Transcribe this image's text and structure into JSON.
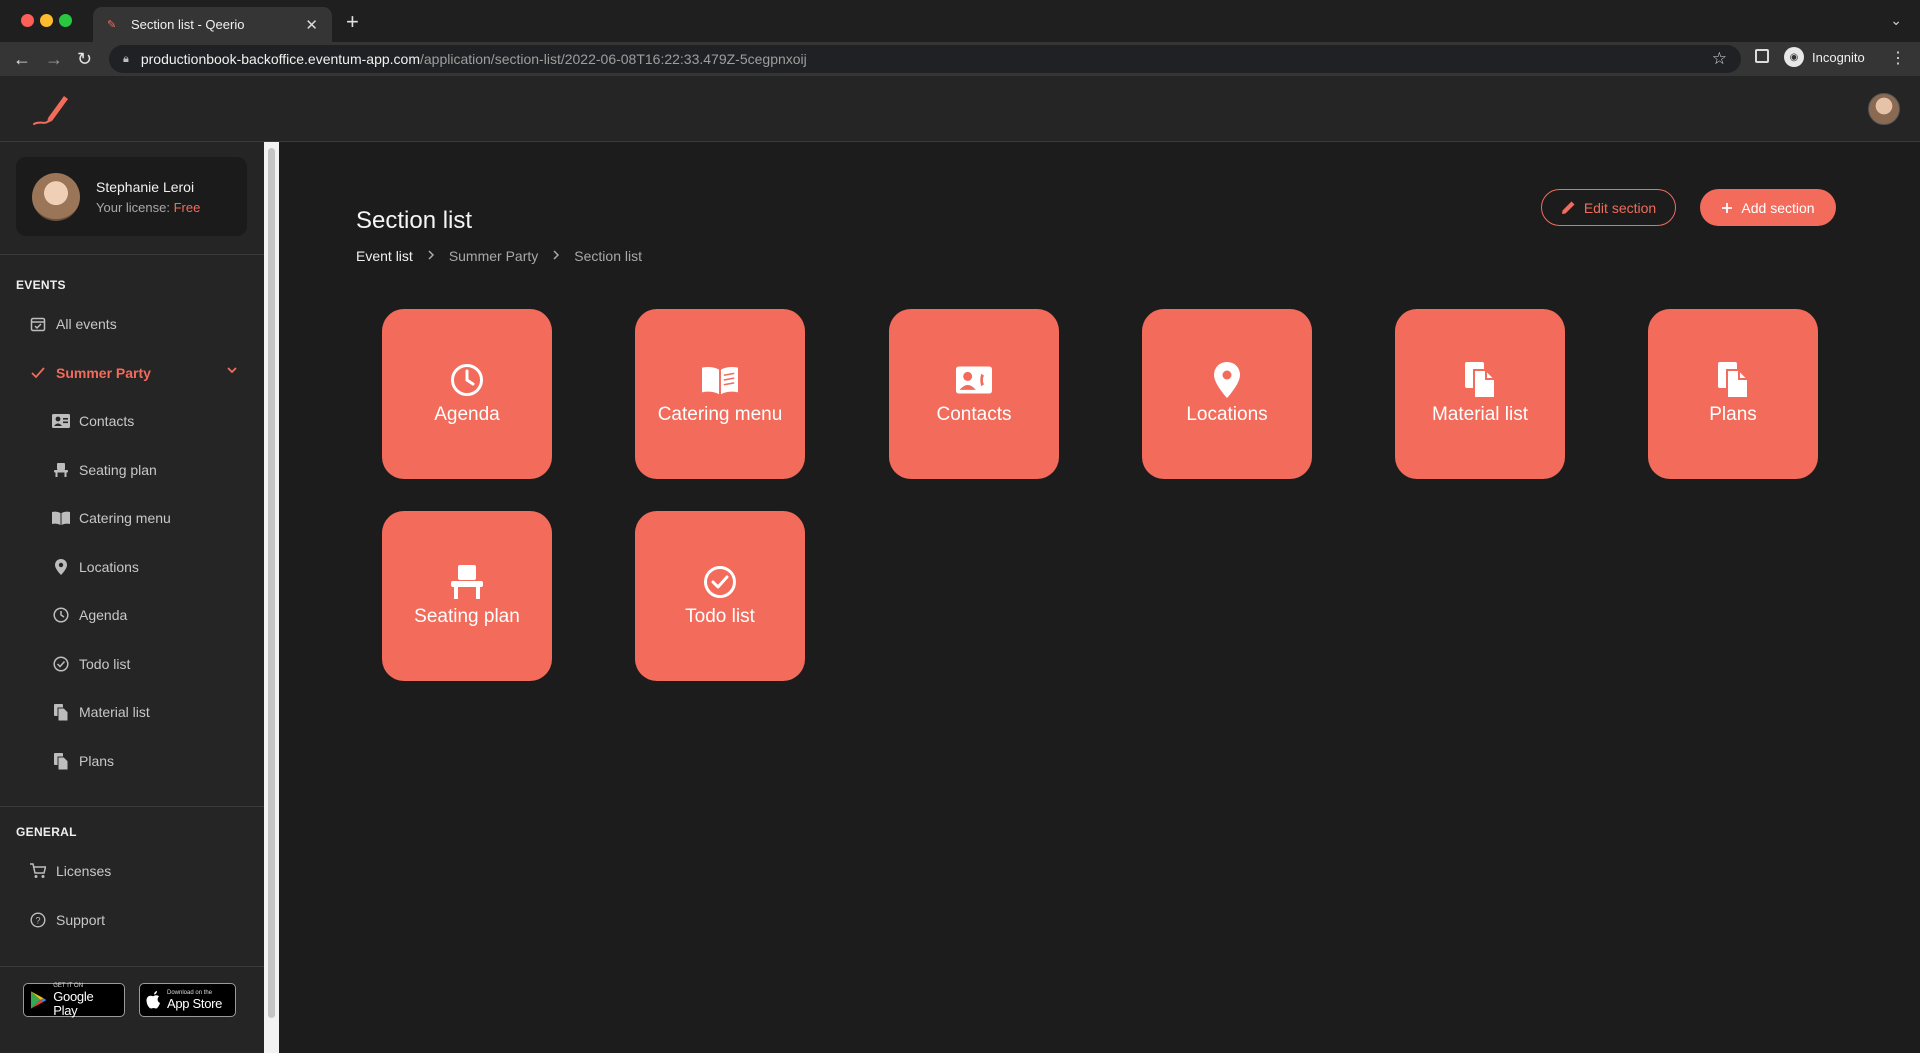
{
  "browser": {
    "tab_title": "Section list - Qeerio",
    "url_host": "productionbook-backoffice.eventum-app.com",
    "url_path": "/application/section-list/2022-06-08T16:22:33.479Z-5cegpnxoij",
    "profile_label": "Incognito"
  },
  "profile": {
    "name": "Stephanie Leroi",
    "license_label": "Your license:",
    "license_value": "Free"
  },
  "sidebar": {
    "events_label": "EVENTS",
    "all_events": "All events",
    "current_event": "Summer Party",
    "event_items": [
      {
        "label": "Contacts",
        "icon": "contacts-icon"
      },
      {
        "label": "Seating plan",
        "icon": "seat-icon"
      },
      {
        "label": "Catering menu",
        "icon": "book-icon"
      },
      {
        "label": "Locations",
        "icon": "location-pin-icon"
      },
      {
        "label": "Agenda",
        "icon": "clock-icon"
      },
      {
        "label": "Todo list",
        "icon": "check-circle-icon"
      },
      {
        "label": "Material list",
        "icon": "documents-icon"
      },
      {
        "label": "Plans",
        "icon": "documents-icon"
      }
    ],
    "general_label": "GENERAL",
    "licenses": "Licenses",
    "support": "Support",
    "google_play_small": "GET IT ON",
    "google_play_big": "Google Play",
    "app_store_small": "Download on the",
    "app_store_big": "App Store"
  },
  "page": {
    "title": "Section list",
    "breadcrumb": [
      "Event list",
      "Summer Party",
      "Section list"
    ],
    "edit_button": "Edit section",
    "add_button": "Add section"
  },
  "tiles": [
    {
      "label": "Agenda",
      "icon": "clock-icon"
    },
    {
      "label": "Catering menu",
      "icon": "book-icon"
    },
    {
      "label": "Contacts",
      "icon": "contacts-icon"
    },
    {
      "label": "Locations",
      "icon": "location-pin-icon"
    },
    {
      "label": "Material list",
      "icon": "documents-icon"
    },
    {
      "label": "Plans",
      "icon": "documents-icon"
    },
    {
      "label": "Seating plan",
      "icon": "seat-icon"
    },
    {
      "label": "Todo list",
      "icon": "check-circle-icon"
    }
  ],
  "colors": {
    "accent": "#f26b5b",
    "background": "#1c1c1c",
    "sidebar": "#252525"
  }
}
